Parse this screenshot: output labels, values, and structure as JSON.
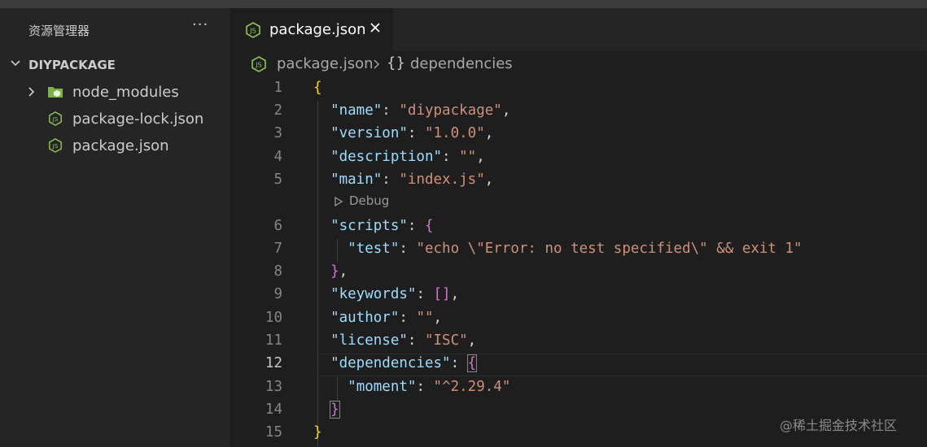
{
  "explorer": {
    "title": "资源管理器",
    "more": "···",
    "section": "DIYPACKAGE",
    "items": [
      {
        "name": "node_modules",
        "icon": "folder-icon"
      },
      {
        "name": "package-lock.json",
        "icon": "nodejs-icon"
      },
      {
        "name": "package.json",
        "icon": "nodejs-icon"
      }
    ]
  },
  "tab": {
    "label": "package.json"
  },
  "breadcrumb": {
    "file": "package.json",
    "symbol_icon": "{}",
    "symbol": "dependencies"
  },
  "codelens": {
    "label": "Debug"
  },
  "editor": {
    "active_line": "12",
    "lines": [
      {
        "n": "1"
      },
      {
        "n": "2"
      },
      {
        "n": "3"
      },
      {
        "n": "4"
      },
      {
        "n": "5"
      },
      {
        "n": "6"
      },
      {
        "n": "7"
      },
      {
        "n": "8"
      },
      {
        "n": "9"
      },
      {
        "n": "10"
      },
      {
        "n": "11"
      },
      {
        "n": "12"
      },
      {
        "n": "13"
      },
      {
        "n": "14"
      },
      {
        "n": "15"
      }
    ],
    "keys": {
      "name": "\"name\"",
      "version": "\"version\"",
      "description": "\"description\"",
      "main": "\"main\"",
      "scripts": "\"scripts\"",
      "test": "\"test\"",
      "keywords": "\"keywords\"",
      "author": "\"author\"",
      "license": "\"license\"",
      "dependencies": "\"dependencies\"",
      "moment": "\"moment\""
    },
    "values": {
      "name": "\"diypackage\"",
      "version": "\"1.0.0\"",
      "description": "\"\"",
      "main": "\"index.js\"",
      "test": "\"echo \\\"Error: no test specified\\\" && exit 1\"",
      "keywords": "[]",
      "author": "\"\"",
      "license": "\"ISC\"",
      "moment": "\"^2.29.4\""
    }
  },
  "colors": {
    "key": "#9cdcfe",
    "string": "#ce9178",
    "brace_level1": "#ffd700",
    "brace_level2": "#da70d6",
    "nodejs_icon": "#8cc84b",
    "folder_icon": "#7cb342"
  },
  "watermark": "@稀土掘金技术社区"
}
